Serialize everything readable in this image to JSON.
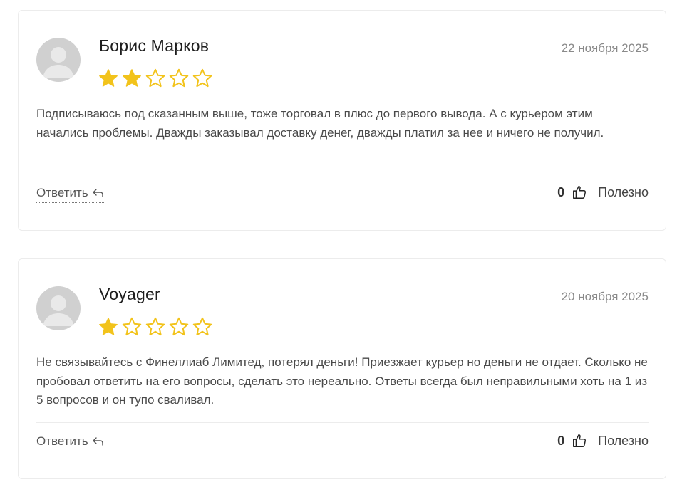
{
  "reviews": [
    {
      "author": "Борис Марков",
      "date": "22 ноября 2025",
      "rating": 2,
      "max_rating": 5,
      "text": "Подписываюсь под сказанным выше, тоже торговал в плюс до первого вывода. А с курьером этим начались проблемы. Дважды заказывал доставку денег, дважды платил за нее и ничего не получил.",
      "reply_label": "Ответить",
      "helpful_count": "0",
      "helpful_label": "Полезно"
    },
    {
      "author": "Voyager",
      "date": "20 ноября 2025",
      "rating": 1,
      "max_rating": 5,
      "text": "Не связывайтесь с Финеллиаб Лимитед, потерял деньги! Приезжает курьер но деньги не отдает. Сколько не пробовал ответить на его вопросы, сделать это нереально. Ответы всегда был неправильными хоть на 1 из 5 вопросов и он тупо сваливал.",
      "reply_label": "Ответить",
      "helpful_count": "0",
      "helpful_label": "Полезно"
    }
  ],
  "icons": {
    "avatar": "user-avatar-placeholder",
    "star": "star-icon",
    "reply": "reply-arrow-icon",
    "helpful": "thumbs-up-icon"
  },
  "colors": {
    "star": "#f2c31b",
    "border": "#ececec",
    "date": "#8a8a8a",
    "avatar": "#d0d0d0"
  }
}
